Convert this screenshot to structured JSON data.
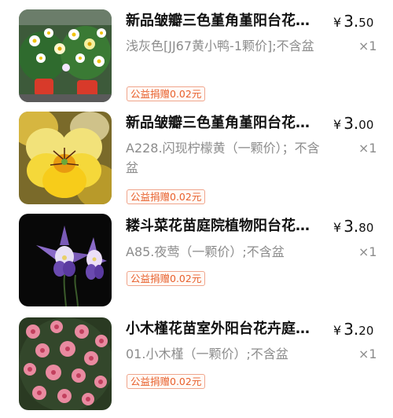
{
  "items": [
    {
      "title": "新品皱瓣三色堇角堇阳台花卉盆栽",
      "spec": "浅灰色[JJ67黄小鸭-1颗价];不含盆",
      "price_currency": "¥",
      "price_int": "3.",
      "price_dec": "50",
      "qty": "×1",
      "badge": "公益捐赠0.02元",
      "image_icon": "pansy-pots-photo"
    },
    {
      "title": "新品皱瓣三色堇角堇阳台花卉盆栽",
      "spec": "A228.闪现柠檬黄（一颗价）；不含盆",
      "price_currency": "¥",
      "price_int": "3.",
      "price_dec": "00",
      "qty": "×1",
      "badge": "公益捐赠0.02元",
      "image_icon": "yellow-pansy-photo"
    },
    {
      "title": "耧斗菜花苗庭院植物阳台花卉盆栽",
      "spec": "A85.夜莺（一颗价）;不含盆",
      "price_currency": "¥",
      "price_int": "3.",
      "price_dec": "80",
      "qty": "×1",
      "badge": "公益捐赠0.02元",
      "image_icon": "columbine-photo"
    },
    {
      "title": "小木槿花苗室外阳台花卉庭院植物",
      "spec": "01.小木槿（一颗价）;不含盆",
      "price_currency": "¥",
      "price_int": "3.",
      "price_dec": "20",
      "qty": "×1",
      "badge": "公益捐赠0.02元",
      "image_icon": "pink-anisodontea-photo"
    }
  ]
}
